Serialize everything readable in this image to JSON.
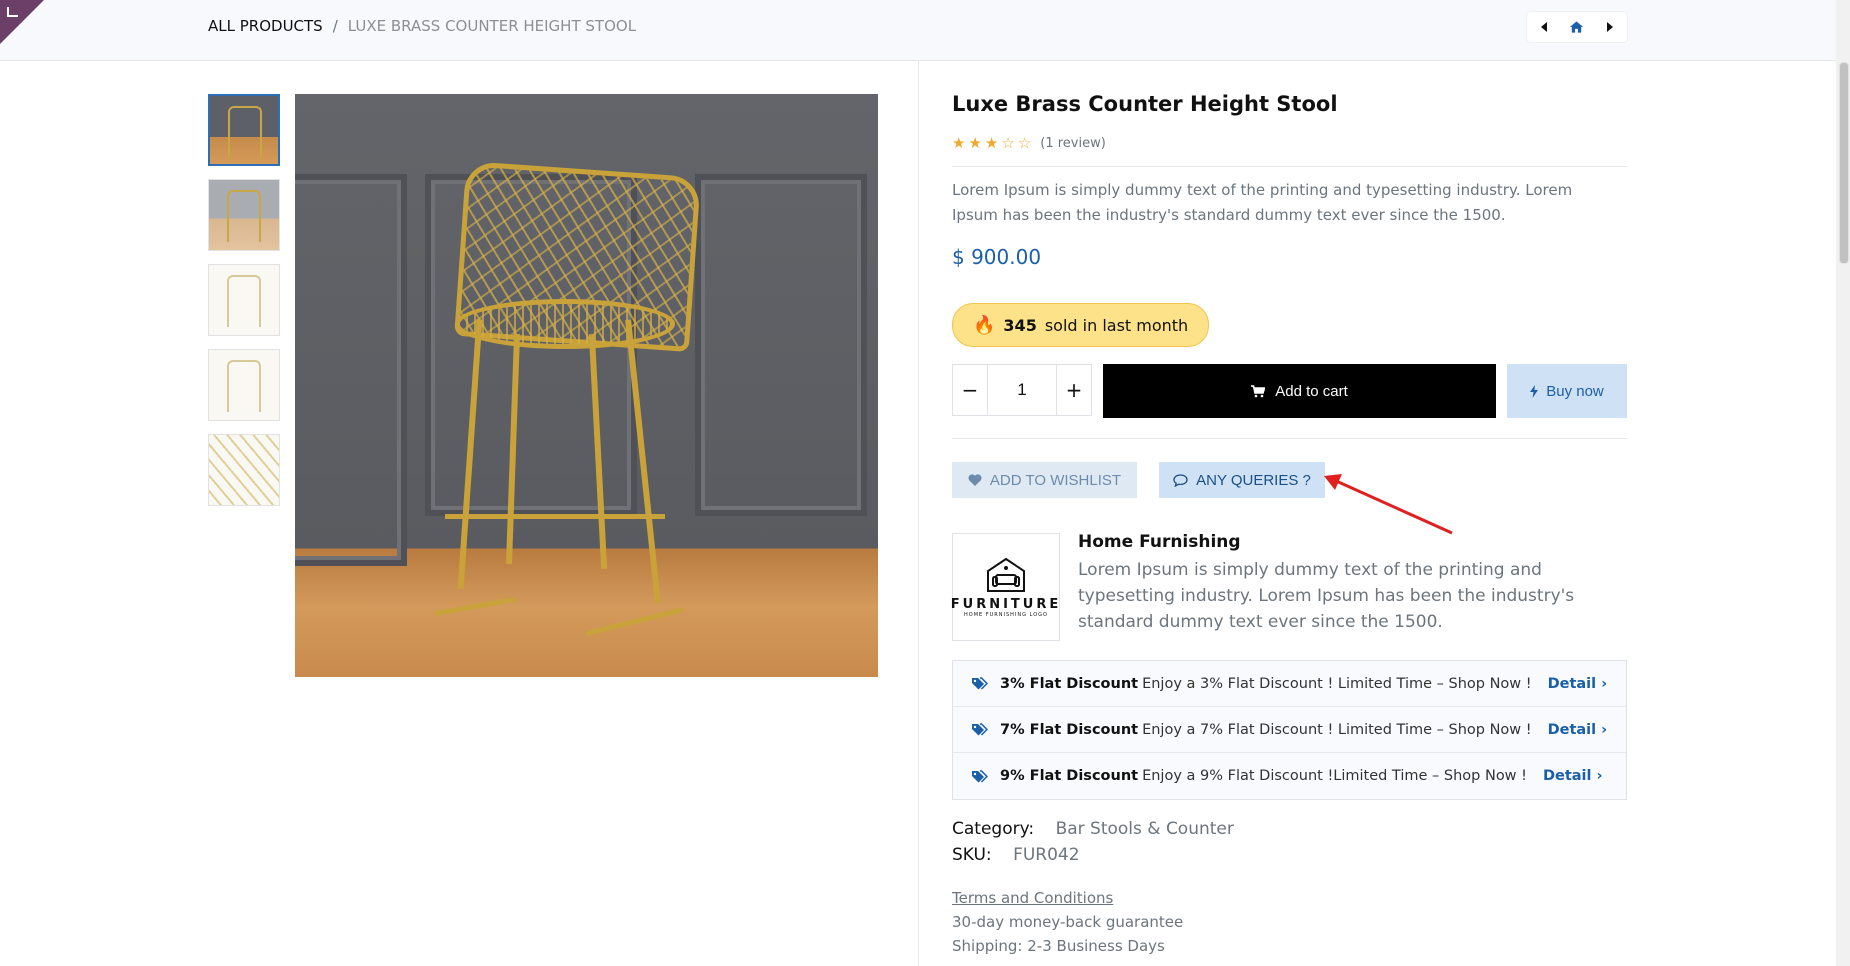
{
  "breadcrumb": {
    "root": "ALL PRODUCTS",
    "separator": "/",
    "current": "LUXE BRASS COUNTER HEIGHT STOOL"
  },
  "pager": {
    "prev_icon": "caret-left-icon",
    "home_icon": "home-icon",
    "next_icon": "caret-right-icon"
  },
  "product": {
    "title": "Luxe Brass Counter Height Stool",
    "rating": 3,
    "rating_max": 5,
    "review_text": "(1 review)",
    "description": "Lorem Ipsum is simply dummy text of the printing and typesetting industry. Lorem Ipsum has been the industry's standard dummy text ever since the 1500.",
    "price": "$ 900.00",
    "sold_count": "345",
    "sold_text": "sold in last month"
  },
  "cart": {
    "minus": "−",
    "plus": "+",
    "quantity": "1",
    "add_to_cart": "Add to cart",
    "buy_now": "Buy now"
  },
  "actions": {
    "wishlist": "ADD TO WISHLIST",
    "queries": "ANY QUERIES ?"
  },
  "brand": {
    "logo_word": "FURNITURE",
    "logo_sub": "HOME FURNISHING LOGO",
    "title": "Home Furnishing",
    "description": "Lorem Ipsum is simply dummy text of the printing and typesetting industry. Lorem Ipsum has been the industry's standard dummy text ever since the 1500."
  },
  "offers": [
    {
      "title": "3% Flat Discount",
      "text": "Enjoy a 3% Flat Discount ! Limited Time – Shop Now !",
      "link": "Detail"
    },
    {
      "title": "7% Flat Discount",
      "text": "Enjoy a 7% Flat Discount ! Limited Time – Shop Now !",
      "link": "Detail"
    },
    {
      "title": "9% Flat Discount",
      "text": "Enjoy a 9% Flat Discount !Limited Time – Shop Now !",
      "link": "Detail"
    }
  ],
  "meta": {
    "category_label": "Category:",
    "category_value": "Bar Stools & Counter",
    "sku_label": "SKU:",
    "sku_value": "FUR042"
  },
  "policies": {
    "terms": "Terms and Conditions",
    "guarantee": "30-day money-back guarantee",
    "shipping": "Shipping: 2-3 Business Days"
  },
  "colors": {
    "accent": "#1b5fa9",
    "badge_bg": "#fde28a",
    "star": "#f0a92e",
    "annotation_arrow": "#e02020"
  }
}
